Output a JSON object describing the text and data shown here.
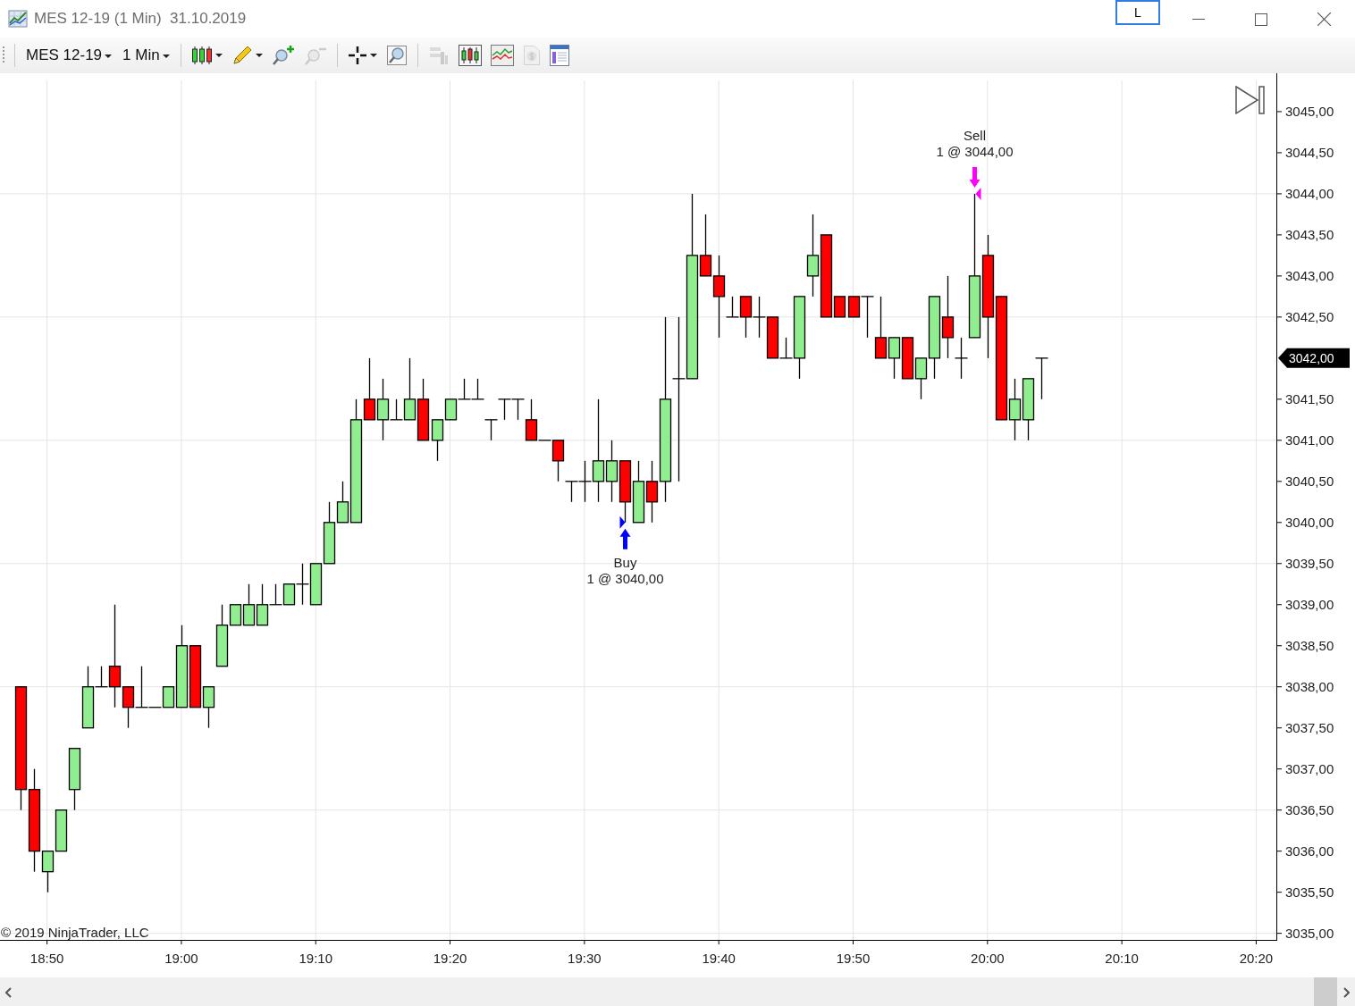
{
  "window": {
    "title": "MES 12-19 (1 Min)  31.10.2019",
    "link_button": "L"
  },
  "toolbar": {
    "instrument": "MES 12-19",
    "interval": "1 Min",
    "tool_groups": [
      [
        {
          "kind": "chart-style",
          "caret": true,
          "disabled": false
        },
        {
          "kind": "pencil",
          "caret": true,
          "disabled": false
        },
        {
          "kind": "zoom-in",
          "caret": false,
          "disabled": false
        },
        {
          "kind": "zoom-out",
          "caret": false,
          "disabled": true
        }
      ],
      [
        {
          "kind": "crosshair",
          "caret": true,
          "disabled": false
        },
        {
          "kind": "magnifier",
          "caret": false,
          "disabled": false
        }
      ],
      [
        {
          "kind": "strategy",
          "caret": false,
          "disabled": true
        },
        {
          "kind": "data-box",
          "caret": false,
          "disabled": false
        },
        {
          "kind": "indicators",
          "caret": false,
          "disabled": false
        },
        {
          "kind": "dollar",
          "caret": false,
          "disabled": true
        },
        {
          "kind": "properties",
          "caret": false,
          "disabled": false
        }
      ]
    ]
  },
  "chart": {
    "last_price": "3042,00",
    "copyright": "© 2019 NinjaTrader, LLC",
    "chart_data": {
      "type": "candlestick",
      "grid": true,
      "categories": [
        null,
        null,
        null,
        "18:50",
        null,
        null,
        null,
        null,
        null,
        null,
        null,
        null,
        null,
        "19:00",
        null,
        null,
        null,
        null,
        null,
        null,
        null,
        null,
        null,
        "19:10",
        null,
        null,
        null,
        null,
        null,
        null,
        null,
        null,
        null,
        "19:20",
        null,
        null,
        null,
        null,
        null,
        null,
        null,
        null,
        null,
        "19:30",
        null,
        null,
        null,
        null,
        null,
        null,
        null,
        null,
        null,
        "19:40",
        null,
        null,
        null,
        null,
        null,
        null,
        null,
        null,
        null,
        "19:50",
        null,
        null,
        null,
        null,
        null,
        null,
        null,
        null,
        null,
        "20:00",
        null,
        null,
        null,
        null,
        null,
        null,
        null,
        null,
        null,
        "20:10",
        null,
        null,
        null,
        null,
        null,
        null,
        null,
        null,
        null,
        "20:20",
        null
      ],
      "ohlc": [
        null,
        [
          3038,
          3038,
          3036.5,
          3036.75
        ],
        [
          3036.75,
          3037,
          3035.75,
          3036
        ],
        [
          3035.75,
          3036,
          3035.5,
          3036
        ],
        [
          3036,
          3036.5,
          3036,
          3036.5
        ],
        [
          3036.75,
          3037.25,
          3036.5,
          3037.25
        ],
        [
          3037.5,
          3038.25,
          3037.5,
          3038
        ],
        [
          3038,
          3038.25,
          3038,
          3038
        ],
        [
          3038.25,
          3039,
          3037.75,
          3038
        ],
        [
          3038,
          3038,
          3037.5,
          3037.75
        ],
        [
          3037.75,
          3038.25,
          3037.75,
          3037.75
        ],
        [
          3037.75,
          3037.75,
          3037.75,
          3037.75
        ],
        [
          3037.75,
          3038,
          3037.75,
          3038
        ],
        [
          3037.75,
          3038.75,
          3037.75,
          3038.5
        ],
        [
          3038.5,
          3038.5,
          3037.75,
          3037.75
        ],
        [
          3037.75,
          3038,
          3037.5,
          3038
        ],
        [
          3038.25,
          3039,
          3038.25,
          3038.75
        ],
        [
          3038.75,
          3039,
          3038.75,
          3039
        ],
        [
          3038.75,
          3039.25,
          3038.75,
          3039
        ],
        [
          3038.75,
          3039.25,
          3038.75,
          3039
        ],
        [
          3039,
          3039.25,
          3039,
          3039
        ],
        [
          3039,
          3039.25,
          3039,
          3039.25
        ],
        [
          3039.25,
          3039.5,
          3039,
          3039.25
        ],
        [
          3039,
          3039.5,
          3039,
          3039.5
        ],
        [
          3039.5,
          3040.25,
          3039.5,
          3040
        ],
        [
          3040,
          3040.5,
          3040,
          3040.25
        ],
        [
          3040,
          3041.5,
          3040,
          3041.25
        ],
        [
          3041.5,
          3042,
          3041.25,
          3041.25
        ],
        [
          3041.25,
          3041.75,
          3041,
          3041.5
        ],
        [
          3041.25,
          3041.5,
          3041.25,
          3041.25
        ],
        [
          3041.25,
          3042,
          3041.25,
          3041.5
        ],
        [
          3041.5,
          3041.75,
          3041,
          3041
        ],
        [
          3041,
          3041.25,
          3040.75,
          3041.25
        ],
        [
          3041.25,
          3041.5,
          3041.25,
          3041.5
        ],
        [
          3041.5,
          3041.75,
          3041.5,
          3041.5
        ],
        [
          3041.5,
          3041.75,
          3041.5,
          3041.5
        ],
        [
          3041.25,
          3041.25,
          3041,
          3041.25
        ],
        [
          3041.5,
          3041.5,
          3041.25,
          3041.5
        ],
        [
          3041.5,
          3041.5,
          3041.25,
          3041.5
        ],
        [
          3041.25,
          3041.5,
          3041,
          3041
        ],
        [
          3041,
          3041,
          3041,
          3041
        ],
        [
          3041,
          3041,
          3040.5,
          3040.75
        ],
        [
          3040.5,
          3040.5,
          3040.25,
          3040.5
        ],
        [
          3040.5,
          3040.75,
          3040.25,
          3040.5
        ],
        [
          3040.5,
          3041.5,
          3040.25,
          3040.75
        ],
        [
          3040.5,
          3041,
          3040.25,
          3040.75
        ],
        [
          3040.75,
          3040.75,
          3040,
          3040.25
        ],
        [
          3040,
          3040.75,
          3040,
          3040.5
        ],
        [
          3040.5,
          3040.75,
          3040,
          3040.25
        ],
        [
          3040.5,
          3042.5,
          3040.25,
          3041.5
        ],
        [
          3041.75,
          3042.5,
          3040.5,
          3041.75
        ],
        [
          3041.75,
          3044,
          3041.75,
          3043.25
        ],
        [
          3043.25,
          3043.75,
          3043,
          3043
        ],
        [
          3043,
          3043.25,
          3042.25,
          3042.75
        ],
        [
          3042.5,
          3042.75,
          3042.5,
          3042.5
        ],
        [
          3042.75,
          3042.75,
          3042.25,
          3042.5
        ],
        [
          3042.5,
          3042.75,
          3042.25,
          3042.5
        ],
        [
          3042.5,
          3042.5,
          3042,
          3042
        ],
        [
          3042,
          3042.25,
          3042,
          3042
        ],
        [
          3042,
          3042.75,
          3041.75,
          3042.75
        ],
        [
          3043,
          3043.75,
          3042.75,
          3043.25
        ],
        [
          3043.5,
          3043.5,
          3042.5,
          3042.5
        ],
        [
          3042.75,
          3042.75,
          3042.5,
          3042.5
        ],
        [
          3042.75,
          3042.75,
          3042.5,
          3042.5
        ],
        [
          3042.75,
          3042.75,
          3042.25,
          3042.75
        ],
        [
          3042.25,
          3042.75,
          3042,
          3042
        ],
        [
          3042,
          3042.25,
          3041.75,
          3042.25
        ],
        [
          3042.25,
          3042.25,
          3041.75,
          3041.75
        ],
        [
          3041.75,
          3042,
          3041.5,
          3042
        ],
        [
          3042,
          3042.75,
          3041.75,
          3042.75
        ],
        [
          3042.5,
          3043,
          3042,
          3042.25
        ],
        [
          3042,
          3042.25,
          3041.75,
          3042
        ],
        [
          3042.25,
          3044,
          3042.25,
          3043
        ],
        [
          3043.25,
          3043.5,
          3042,
          3042.5
        ],
        [
          3042.75,
          3042.75,
          3041.25,
          3041.25
        ],
        [
          3041.25,
          3041.75,
          3041,
          3041.5
        ],
        [
          3041.25,
          3041.75,
          3041,
          3041.75
        ],
        [
          3042,
          3042,
          3041.5,
          3042
        ],
        null,
        null,
        null,
        null,
        null,
        null,
        null,
        null,
        null,
        null,
        null,
        null,
        null,
        null,
        null,
        null,
        null
      ],
      "ylim": [
        3034.92,
        3045.38
      ],
      "yticks": [
        {
          "value": 3035,
          "label": "3035,00"
        },
        {
          "value": 3035.5,
          "label": "3035,50"
        },
        {
          "value": 3036,
          "label": "3036,00"
        },
        {
          "value": 3036.5,
          "label": "3036,50"
        },
        {
          "value": 3037,
          "label": "3037,00"
        },
        {
          "value": 3037.5,
          "label": "3037,50"
        },
        {
          "value": 3038,
          "label": "3038,00"
        },
        {
          "value": 3038.5,
          "label": "3038,50"
        },
        {
          "value": 3039,
          "label": "3039,00"
        },
        {
          "value": 3039.5,
          "label": "3039,50"
        },
        {
          "value": 3040,
          "label": "3040,00"
        },
        {
          "value": 3040.5,
          "label": "3040,50"
        },
        {
          "value": 3041,
          "label": "3041,00"
        },
        {
          "value": 3041.5,
          "label": "3041,50"
        },
        {
          "value": 3042.5,
          "label": "3042,50"
        },
        {
          "value": 3043,
          "label": "3043,00"
        },
        {
          "value": 3043.5,
          "label": "3043,50"
        },
        {
          "value": 3044,
          "label": "3044,00"
        },
        {
          "value": 3044.5,
          "label": "3044,50"
        },
        {
          "value": 3045,
          "label": "3045,00"
        }
      ],
      "annotations": [
        {
          "y": 3040,
          "text": "Buy\n1 @ 3040,00"
        },
        {
          "y": 3044,
          "text": "Sell\n1 @ 3044,00"
        }
      ]
    }
  }
}
